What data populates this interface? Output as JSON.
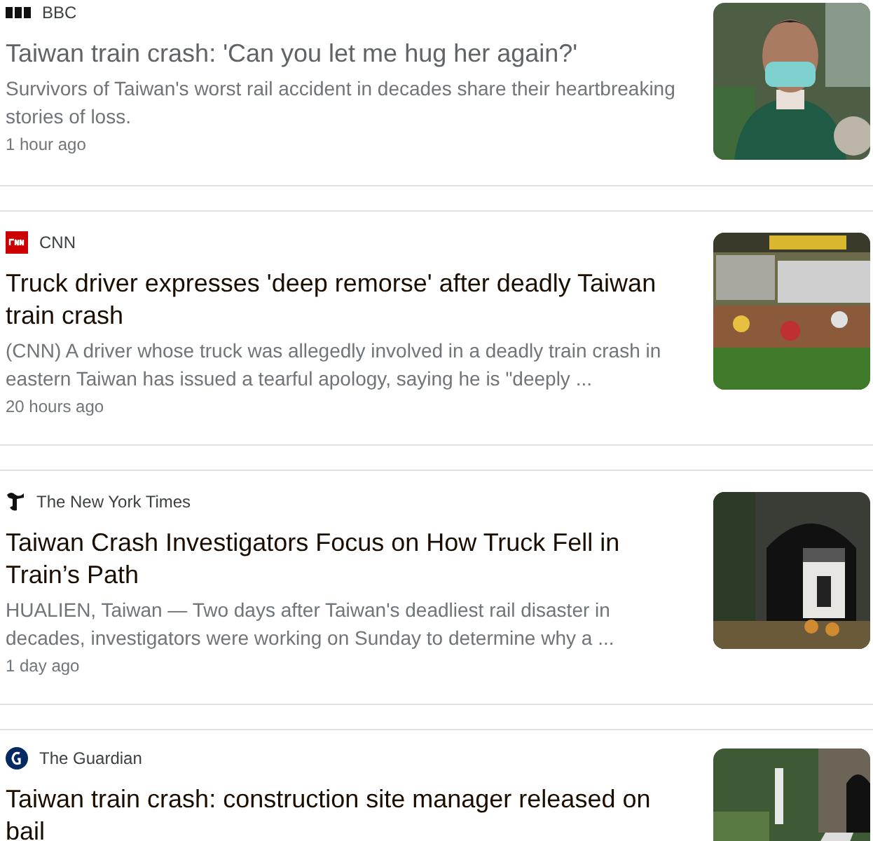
{
  "articles": [
    {
      "source": "BBC",
      "title": "Taiwan train crash: 'Can you let me hug her again?'",
      "visited": true,
      "snippet": "Survivors of Taiwan's worst rail accident in decades share their heartbreaking stories of loss.",
      "time": "1 hour ago"
    },
    {
      "source": "CNN",
      "title": "Truck driver expresses 'deep remorse' after deadly Taiwan train crash",
      "visited": false,
      "snippet": "(CNN) A driver whose truck was allegedly involved in a deadly train crash in eastern Taiwan has issued a tearful apology, saying he is \"deeply ...",
      "time": "20 hours ago"
    },
    {
      "source": "The New York Times",
      "title": "Taiwan Crash Investigators Focus on How Truck Fell in Train’s Path",
      "visited": false,
      "snippet": "HUALIEN, Taiwan — Two days after Taiwan's deadliest rail disaster in decades, investigators were working on Sunday to determine why a ...",
      "time": "1 day ago"
    },
    {
      "source": "The Guardian",
      "title": "Taiwan train crash: construction site manager released on bail",
      "visited": false
    }
  ]
}
